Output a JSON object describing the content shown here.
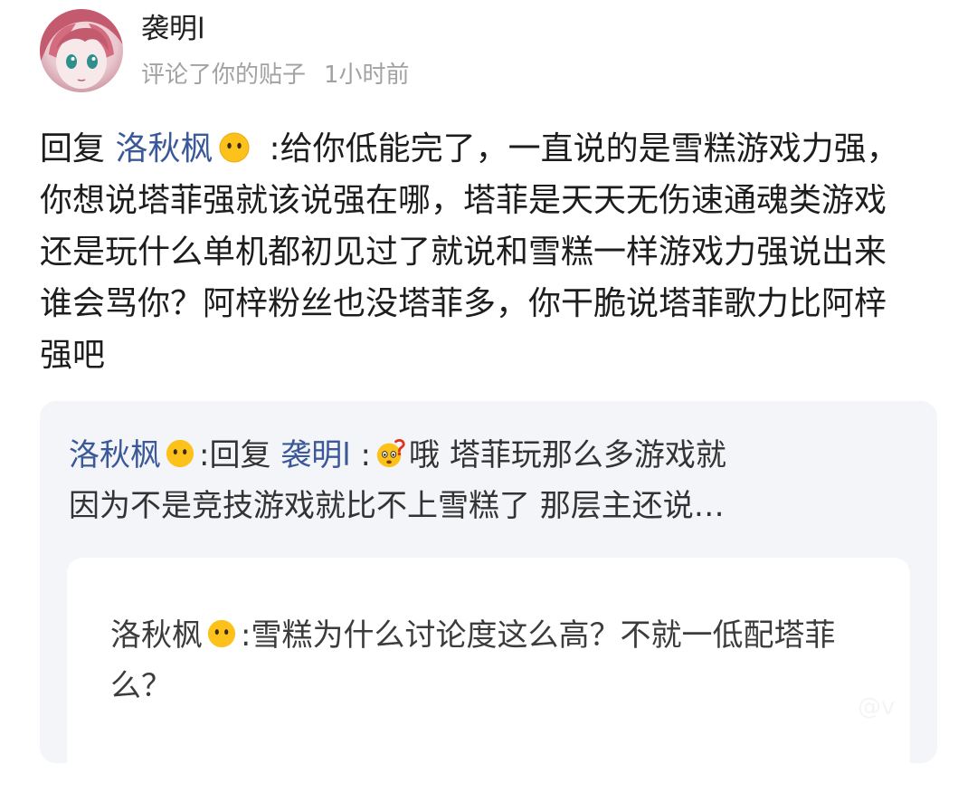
{
  "header": {
    "user_name": "袭明l",
    "action_text": "评论了你的贴子",
    "time": "1小时前",
    "avatar_icon": "anime-avatar-icon"
  },
  "main_reply": {
    "prefix": "回复",
    "mention": "洛秋枫",
    "mention_emoji": "no-mouth-face-emoji",
    "text": ":给你低能完了，一直说的是雪糕游戏力强，你想说塔菲强就该说强在哪，塔菲是天天无伤速通魂类游戏还是玩什么单机都初见过了就说和雪糕一样游戏力强说出来谁会骂你？阿梓粉丝也没塔菲多，你干脆说塔菲歌力比阿梓强吧"
  },
  "quote": {
    "author": "洛秋枫",
    "author_emoji": "no-mouth-face-emoji",
    "sep1": ":",
    "reply_word": "回复",
    "reply_to": "袭明l",
    "sep2": ":",
    "thinking_emoji": "thinking-question-face-emoji",
    "line1_text": "哦 塔菲玩那么多游戏就",
    "line2_text": "因为不是竞技游戏就比不上雪糕了 那层主还说…"
  },
  "nested_quote": {
    "author": "洛秋枫",
    "author_emoji": "no-mouth-face-emoji",
    "sep": ":",
    "text": "雪糕为什么讨论度这么高？不就一低配塔菲么？"
  },
  "watermark": {
    "text": "@v"
  },
  "colors": {
    "link": "#3b5998",
    "secondary_text": "#a2a2a2",
    "card_background": "#f4f5f9"
  }
}
